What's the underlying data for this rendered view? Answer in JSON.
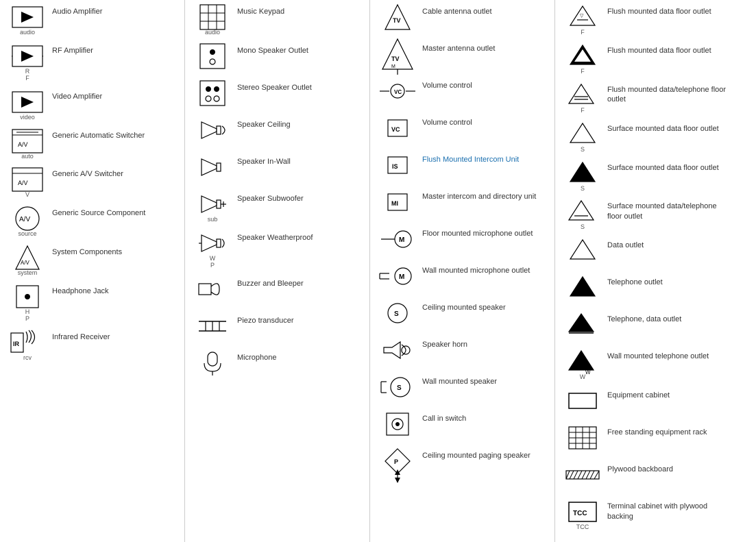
{
  "columns": [
    {
      "items": [
        {
          "symbol": "audio-amplifier",
          "label": "audio",
          "text": "Audio Amplifier"
        },
        {
          "symbol": "rf-amplifier",
          "label": "R\nF",
          "text": "RF Amplifier"
        },
        {
          "symbol": "video-amplifier",
          "label": "video",
          "text": "Video Amplifier"
        },
        {
          "symbol": "generic-auto-switcher",
          "label": "auto",
          "text": "Generic Automatic Switcher"
        },
        {
          "symbol": "generic-av-switcher",
          "label": "V",
          "text": "Generic A/V Switcher"
        },
        {
          "symbol": "generic-source",
          "label": "source",
          "text": "Generic Source Component"
        },
        {
          "symbol": "system-components",
          "label": "system",
          "text": "System Components"
        },
        {
          "symbol": "headphone-jack",
          "label": "H\nP",
          "text": "Headphone Jack"
        },
        {
          "symbol": "infrared-receiver",
          "label": "rcv",
          "text": "Infrared Receiver"
        }
      ]
    },
    {
      "items": [
        {
          "symbol": "music-keypad",
          "label": "audio",
          "text": "Music Keypad"
        },
        {
          "symbol": "mono-speaker-outlet",
          "label": "",
          "text": "Mono Speaker Outlet"
        },
        {
          "symbol": "stereo-speaker-outlet",
          "label": "",
          "text": "Stereo Speaker Outlet"
        },
        {
          "symbol": "speaker-ceiling",
          "label": "",
          "text": "Speaker Ceiling"
        },
        {
          "symbol": "speaker-in-wall",
          "label": "",
          "text": "Speaker In-Wall"
        },
        {
          "symbol": "speaker-subwoofer",
          "label": "sub",
          "text": "Speaker Subwoofer"
        },
        {
          "symbol": "speaker-weatherproof",
          "label": "W\nP",
          "text": "Speaker Weatherproof"
        },
        {
          "symbol": "buzzer-bleeper",
          "label": "",
          "text": "Buzzer and Bleeper"
        },
        {
          "symbol": "piezo-transducer",
          "label": "",
          "text": "Piezo transducer"
        },
        {
          "symbol": "microphone",
          "label": "",
          "text": "Microphone"
        }
      ]
    },
    {
      "items": [
        {
          "symbol": "cable-antenna",
          "label": "",
          "text": "Cable antenna outlet"
        },
        {
          "symbol": "master-antenna",
          "label": "",
          "text": "Master antenna outlet"
        },
        {
          "symbol": "volume-control-line",
          "label": "",
          "text": "Volume control"
        },
        {
          "symbol": "volume-control-box",
          "label": "",
          "text": "Volume control"
        },
        {
          "symbol": "flush-intercom",
          "label": "",
          "text": "Flush Mounted Intercom Unit",
          "blue": true
        },
        {
          "symbol": "master-intercom",
          "label": "",
          "text": "Master intercom and directory unit"
        },
        {
          "symbol": "floor-mic",
          "label": "",
          "text": "Floor mounted microphone outlet"
        },
        {
          "symbol": "wall-mic",
          "label": "",
          "text": "Wall mounted microphone outlet"
        },
        {
          "symbol": "ceiling-speaker",
          "label": "",
          "text": "Ceiling mounted speaker"
        },
        {
          "symbol": "speaker-horn",
          "label": "",
          "text": "Speaker horn"
        },
        {
          "symbol": "wall-speaker",
          "label": "",
          "text": "Wall mounted speaker"
        },
        {
          "symbol": "call-in-switch",
          "label": "",
          "text": "Call in switch"
        },
        {
          "symbol": "ceiling-paging",
          "label": "",
          "text": "Ceiling mounted paging speaker"
        }
      ]
    },
    {
      "items": [
        {
          "symbol": "flush-data-floor-1",
          "label": "F",
          "text": "Flush mounted data floor outlet"
        },
        {
          "symbol": "flush-data-floor-2",
          "label": "F",
          "text": "Flush mounted data floor outlet"
        },
        {
          "symbol": "flush-data-tel-floor",
          "label": "F",
          "text": "Flush mounted data/telephone floor outlet"
        },
        {
          "symbol": "surface-data-floor-1",
          "label": "S",
          "text": "Surface mounted data floor outlet"
        },
        {
          "symbol": "surface-data-floor-2",
          "label": "S",
          "text": "Surface mounted data floor outlet"
        },
        {
          "symbol": "surface-data-tel-floor",
          "label": "S",
          "text": "Surface mounted data/telephone floor outlet"
        },
        {
          "symbol": "data-outlet",
          "label": "",
          "text": "Data outlet"
        },
        {
          "symbol": "telephone-outlet",
          "label": "",
          "text": "Telephone outlet"
        },
        {
          "symbol": "tel-data-outlet",
          "label": "",
          "text": "Telephone, data outlet"
        },
        {
          "symbol": "wall-tel-outlet",
          "label": "W",
          "text": "Wall mounted telephone outlet"
        },
        {
          "symbol": "equipment-cabinet",
          "label": "",
          "text": "Equipment cabinet"
        },
        {
          "symbol": "free-standing-rack",
          "label": "",
          "text": "Free standing equipment rack"
        },
        {
          "symbol": "plywood-backboard",
          "label": "",
          "text": "Plywood backboard"
        },
        {
          "symbol": "terminal-cabinet",
          "label": "TCC",
          "text": "Terminal cabinet with plywood backing"
        }
      ]
    }
  ]
}
